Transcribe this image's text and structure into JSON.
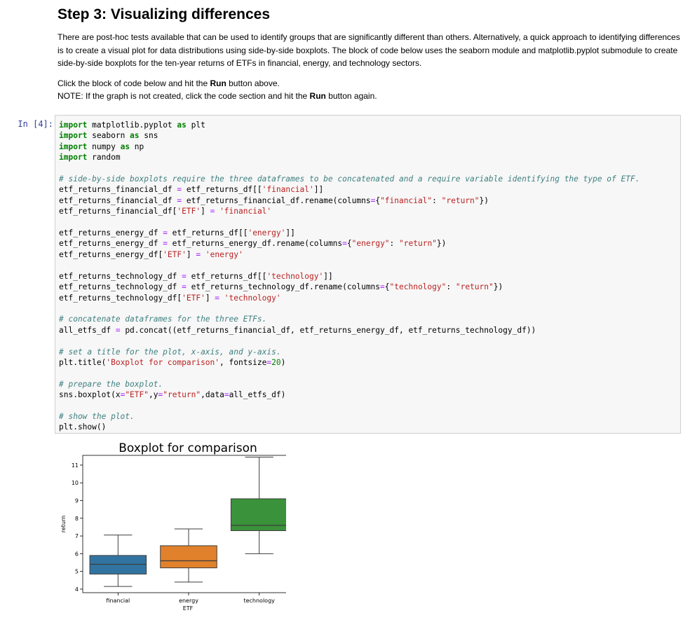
{
  "markdown": {
    "heading": "Step 3: Visualizing differences",
    "para1": "There are post-hoc tests available that can be used to identify groups that are significantly different than others. Alternatively, a quick approach to identifying differences is to create a visual plot for data distributions using side-by-side boxplots. The block of code below uses the seaborn module and matplotlib.pyplot submodule to create side-by-side boxplots for the ten-year returns of ETFs in financial, energy, and technology sectors.",
    "para2_pre": "Click the block of code below and hit the ",
    "para2_bold": "Run",
    "para2_post": " button above.",
    "para3_pre": "NOTE: If the graph is not created, click the code section and hit the ",
    "para3_bold": "Run",
    "para3_post": " button again."
  },
  "cell": {
    "prompt": "In [4]:",
    "lines": [
      "import matplotlib.pyplot as plt",
      "import seaborn as sns",
      "import numpy as np",
      "import random",
      "",
      "# side-by-side boxplots require the three dataframes to be concatenated and a require variable identifying the type of ETF.",
      "etf_returns_financial_df = etf_returns_df[['financial']]",
      "etf_returns_financial_df = etf_returns_financial_df.rename(columns={\"financial\": \"return\"})",
      "etf_returns_financial_df['ETF'] = 'financial'",
      "",
      "etf_returns_energy_df = etf_returns_df[['energy']]",
      "etf_returns_energy_df = etf_returns_energy_df.rename(columns={\"energy\": \"return\"})",
      "etf_returns_energy_df['ETF'] = 'energy'",
      "",
      "etf_returns_technology_df = etf_returns_df[['technology']]",
      "etf_returns_technology_df = etf_returns_technology_df.rename(columns={\"technology\": \"return\"})",
      "etf_returns_technology_df['ETF'] = 'technology'",
      "",
      "# concatenate dataframes for the three ETFs.",
      "all_etfs_df = pd.concat((etf_returns_financial_df, etf_returns_energy_df, etf_returns_technology_df))",
      "",
      "# set a title for the plot, x-axis, and y-axis.",
      "plt.title('Boxplot for comparison', fontsize=20)",
      "",
      "# prepare the boxplot.",
      "sns.boxplot(x=\"ETF\",y=\"return\",data=all_etfs_df)",
      "",
      "# show the plot.",
      "plt.show()"
    ]
  },
  "chart_data": {
    "type": "box",
    "title": "Boxplot for comparison",
    "xlabel": "ETF",
    "ylabel": "return",
    "categories": [
      "financial",
      "energy",
      "technology"
    ],
    "colors": [
      "#3274a1",
      "#e1812c",
      "#3a923a"
    ],
    "ylim": [
      3.8,
      11.55
    ],
    "yticks": [
      4,
      5,
      6,
      7,
      8,
      9,
      10,
      11
    ],
    "boxes": [
      {
        "whisker_low": 4.15,
        "q1": 4.85,
        "median": 5.4,
        "q3": 5.9,
        "whisker_high": 7.05
      },
      {
        "whisker_low": 4.4,
        "q1": 5.2,
        "median": 5.6,
        "q3": 6.45,
        "whisker_high": 7.4
      },
      {
        "whisker_low": 6.0,
        "q1": 7.3,
        "median": 7.6,
        "q3": 9.1,
        "whisker_high": 11.45
      }
    ]
  }
}
